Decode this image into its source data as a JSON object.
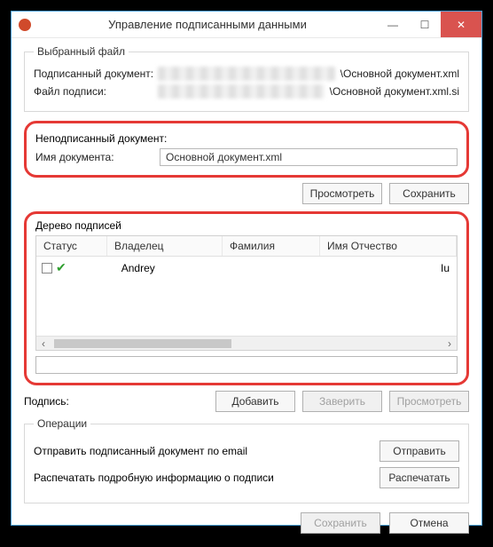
{
  "window": {
    "title": "Управление подписанными данными"
  },
  "selected_file": {
    "legend": "Выбранный файл",
    "signed_doc_label": "Подписанный документ:",
    "signed_doc_suffix": "\\Основной документ.xml",
    "sig_file_label": "Файл подписи:",
    "sig_file_suffix": "\\Основной документ.xml.si"
  },
  "unsigned": {
    "legend": "Неподписанный документ:",
    "name_label": "Имя документа:",
    "name_value": "Основной документ.xml",
    "view_btn": "Просмотреть",
    "save_btn": "Сохранить"
  },
  "tree": {
    "legend": "Дерево подписей",
    "cols": {
      "status": "Статус",
      "owner": "Владелец",
      "surname": "Фамилия",
      "name_patronymic": "Имя Отчество"
    },
    "rows": [
      {
        "owner": "Andrey",
        "tail": "Iu"
      }
    ]
  },
  "signature": {
    "label": "Подпись:",
    "add_btn": "Добавить",
    "verify_btn": "Заверить",
    "view_btn": "Просмотреть"
  },
  "ops": {
    "legend": "Операции",
    "email_text": "Отправить подписанный документ по email",
    "send_btn": "Отправить",
    "print_text": "Распечатать подробную информацию о подписи",
    "print_btn": "Распечатать"
  },
  "footer": {
    "save": "Сохранить",
    "cancel": "Отмена"
  }
}
